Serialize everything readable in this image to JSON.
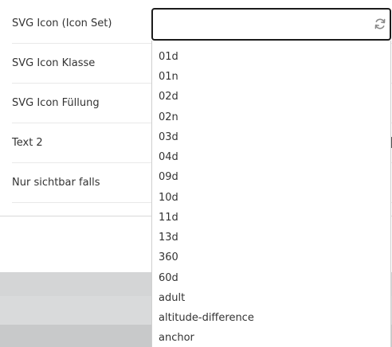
{
  "form": {
    "rows": [
      {
        "label": "SVG Icon (Icon Set)"
      },
      {
        "label": "SVG Icon Klasse"
      },
      {
        "label": "SVG Icon Füllung"
      },
      {
        "label": "Text 2"
      },
      {
        "label": "Nur sichtbar falls"
      }
    ]
  },
  "icon_select": {
    "value": "",
    "refresh_icon": "refresh-icon",
    "options": [
      "01d",
      "01n",
      "02d",
      "02n",
      "03d",
      "04d",
      "09d",
      "10d",
      "11d",
      "13d",
      "360",
      "60d",
      "adult",
      "altitude-difference",
      "anchor"
    ]
  },
  "colors": {
    "focus_border": "#1b1b1b",
    "band": "#d4d5d6"
  }
}
